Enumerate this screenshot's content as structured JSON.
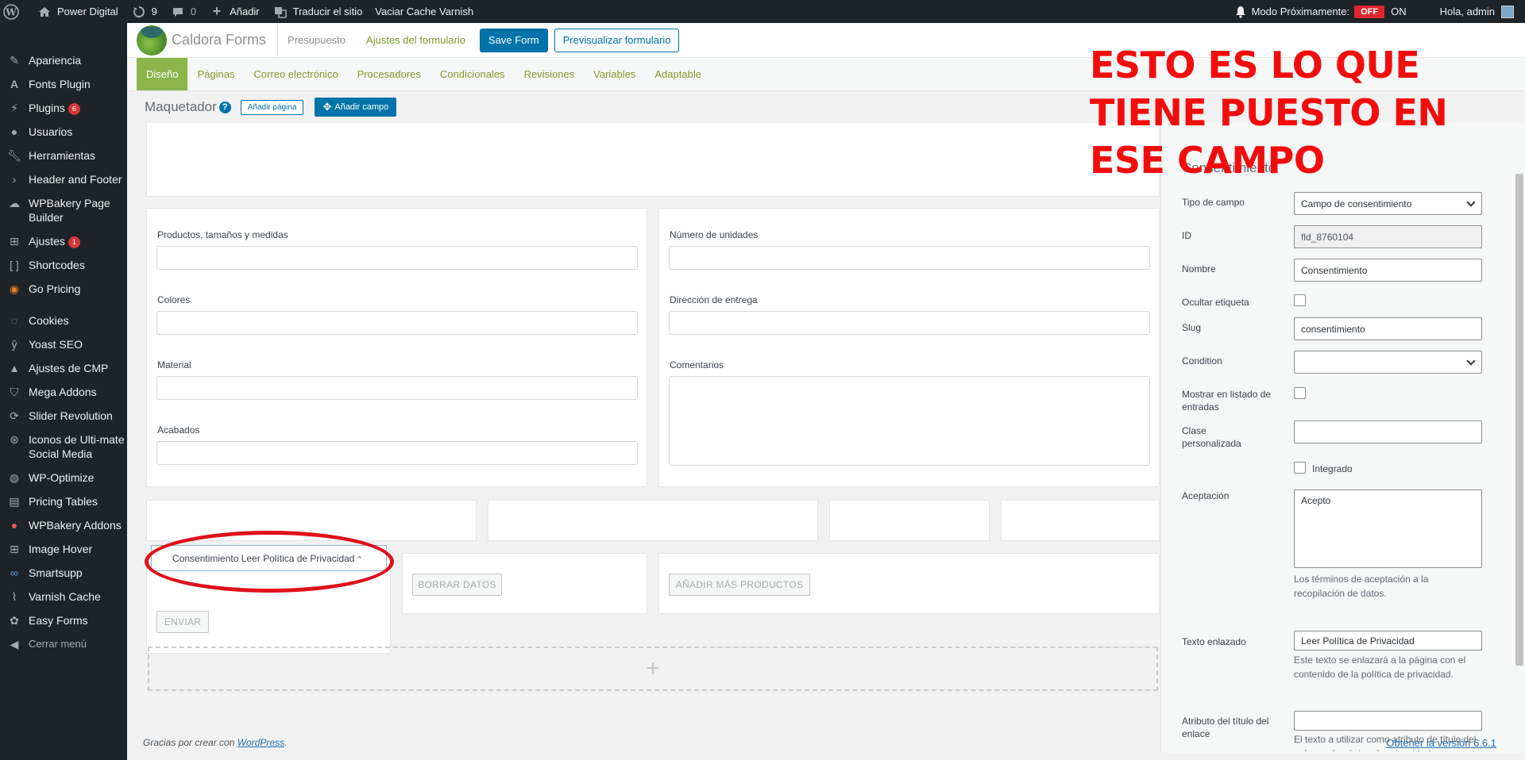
{
  "adminbar": {
    "site_name": "Power Digital",
    "updates_count": "9",
    "comments_count": "0",
    "add_new": "Añadir",
    "translate": "Traducir el sitio",
    "varnish": "Vaciar Cache Varnish",
    "coming_soon": "Modo Próximamente:",
    "off": "OFF",
    "on": "ON",
    "greeting": "Hola, admin"
  },
  "sidebar": {
    "items": [
      {
        "label": "Apariencia"
      },
      {
        "label": "Fonts Plugin"
      },
      {
        "label": "Plugins",
        "badge": "6"
      },
      {
        "label": "Usuarios"
      },
      {
        "label": "Herramientas"
      },
      {
        "label": "Header and Footer"
      },
      {
        "label": "WPBakery Page Builder"
      },
      {
        "label": "Ajustes",
        "badge": "1"
      },
      {
        "label": "Shortcodes"
      },
      {
        "label": "Go Pricing"
      },
      {
        "label": "Cookies"
      },
      {
        "label": "Yoast SEO"
      },
      {
        "label": "Ajustes de CMP"
      },
      {
        "label": "Mega Addons"
      },
      {
        "label": "Slider Revolution"
      },
      {
        "label": "Iconos de Ulti-mate Social Media"
      },
      {
        "label": "WP-Optimize"
      },
      {
        "label": "Pricing Tables"
      },
      {
        "label": "WPBakery Addons"
      },
      {
        "label": "Image Hover"
      },
      {
        "label": "Smartsupp"
      },
      {
        "label": "Varnish Cache"
      },
      {
        "label": "Easy Forms"
      },
      {
        "label": "Cerrar menú"
      }
    ]
  },
  "header": {
    "app_title": "Caldora Forms",
    "form_name": "Presupuesto",
    "settings_tab": "Ajustes del formulario",
    "save_button": "Save Form",
    "preview_button": "Previsualizar formulario"
  },
  "subnav": {
    "tabs": [
      "Diseño",
      "Páginas",
      "Correo electrónico",
      "Procesadores",
      "Condicionales",
      "Revisiones",
      "Variables",
      "Adaptable"
    ]
  },
  "builder": {
    "title": "Maquetador",
    "add_page": "Añadir página",
    "add_field": "Añadir campo",
    "fields_left": [
      "Productos, tamaños y medidas",
      "Colores",
      "Material",
      "Acabados"
    ],
    "fields_right": [
      "Número de unidades",
      "Dirección de entrega",
      "Comentarios"
    ],
    "consent_text": "Consentimiento Leer Política de Privacidad",
    "clear_button": "BORRAR DATOS",
    "add_more_button": "AÑADIR MÁS PRODUCTOS",
    "send_button": "ENVIAR",
    "add_row_symbol": "+"
  },
  "settings": {
    "title": "Consentimiento",
    "field_type_label": "Tipo de campo",
    "field_type_value": "Campo de consentimiento",
    "id_label": "ID",
    "id_value": "fld_8760104",
    "name_label": "Nombre",
    "name_value": "Consentimiento",
    "hide_label": "Ocultar etiqueta",
    "slug_label": "Slug",
    "slug_value": "consentimiento",
    "condition_label": "Condition",
    "show_entries_label": "Mostrar en listado de entradas",
    "custom_class_label": "Clase personalizada",
    "inline_label": "Integrado",
    "acceptance_label": "Aceptación",
    "acceptance_value": "Acepto",
    "acceptance_help": "Los términos de aceptación a la recopilación de datos.",
    "linked_text_label": "Texto enlazado",
    "linked_text_value": "Leer Política de Privacidad",
    "linked_text_help": "Este texto se enlazará a la página con el contenido de la política de privacidad.",
    "title_attr_label": "Atributo del título del enlace",
    "title_attr_help": "El texto a utilizar como atributo de título del enlace a la página de privacidad"
  },
  "overlay": {
    "text": "ESTO ES LO QUE TIENE PUESTO EN ESE CAMPO"
  },
  "footer": {
    "thanks": "Gracias por crear con",
    "wordpress": "WordPress",
    "period": ".",
    "version": "Obtener la versión 6.6.1"
  },
  "colors": {
    "admin_bg": "#1d2327",
    "accent_blue": "#0073aa",
    "green_tab": "#8bb54a",
    "annotation_red": "#f20d0d"
  }
}
